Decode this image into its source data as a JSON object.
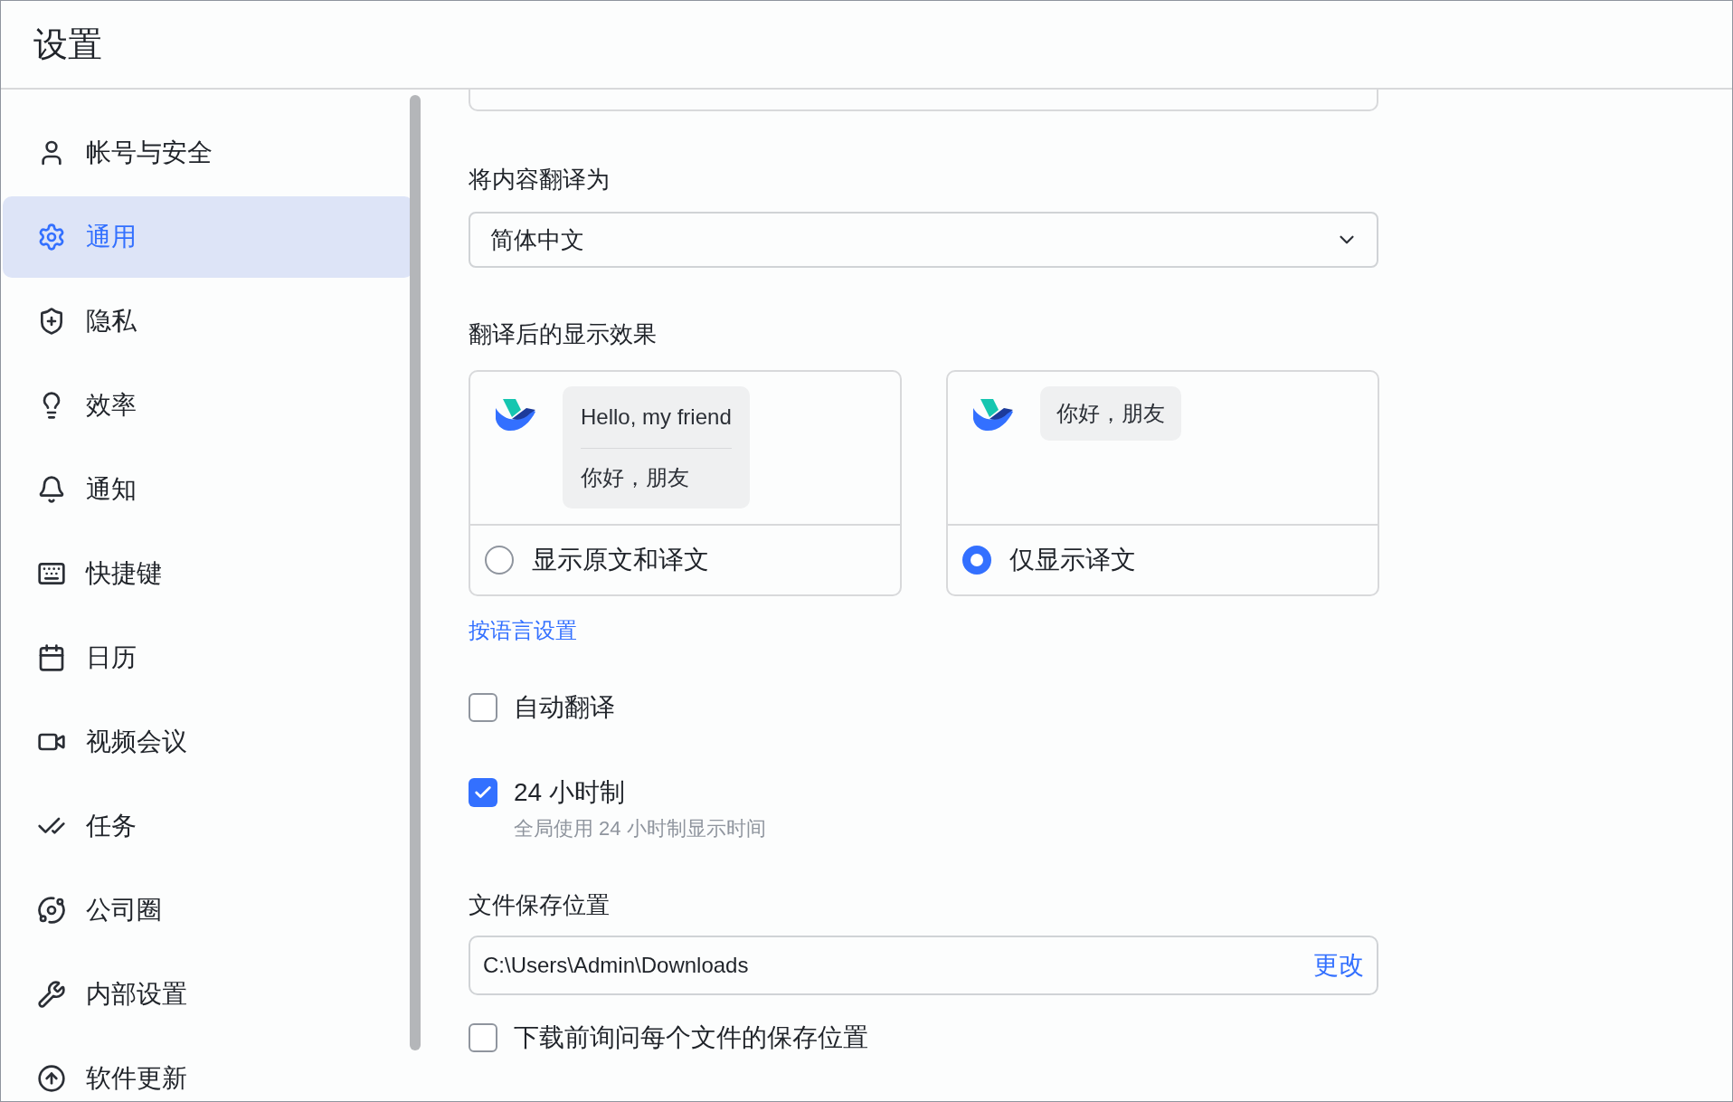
{
  "window": {
    "title": "设置"
  },
  "sidebar": {
    "items": [
      {
        "label": "帐号与安全",
        "selected": false
      },
      {
        "label": "通用",
        "selected": true
      },
      {
        "label": "隐私",
        "selected": false
      },
      {
        "label": "效率",
        "selected": false
      },
      {
        "label": "通知",
        "selected": false
      },
      {
        "label": "快捷键",
        "selected": false
      },
      {
        "label": "日历",
        "selected": false
      },
      {
        "label": "视频会议",
        "selected": false
      },
      {
        "label": "任务",
        "selected": false
      },
      {
        "label": "公司圈",
        "selected": false
      },
      {
        "label": "内部设置",
        "selected": false
      },
      {
        "label": "软件更新",
        "selected": false
      }
    ]
  },
  "translate_to": {
    "label": "将内容翻译为",
    "value": "简体中文"
  },
  "display_effect": {
    "label": "翻译后的显示效果",
    "options": [
      {
        "kind": "bilingual",
        "original": "Hello, my friend",
        "translation": "你好，朋友",
        "label": "显示原文和译文",
        "selected": false
      },
      {
        "kind": "translation_only",
        "translation": "你好，朋友",
        "label": "仅显示译文",
        "selected": true
      }
    ]
  },
  "language_link": "按语言设置",
  "auto_translate": {
    "label": "自动翻译",
    "checked": false
  },
  "clock_24h": {
    "label": "24 小时制",
    "description": "全局使用 24 小时制显示时间",
    "checked": true
  },
  "file_location": {
    "label": "文件保存位置",
    "value": "C:\\Users\\Admin\\Downloads",
    "action": "更改"
  },
  "ask_before_download": {
    "label": "下载前询问每个文件的保存位置",
    "checked": false
  }
}
